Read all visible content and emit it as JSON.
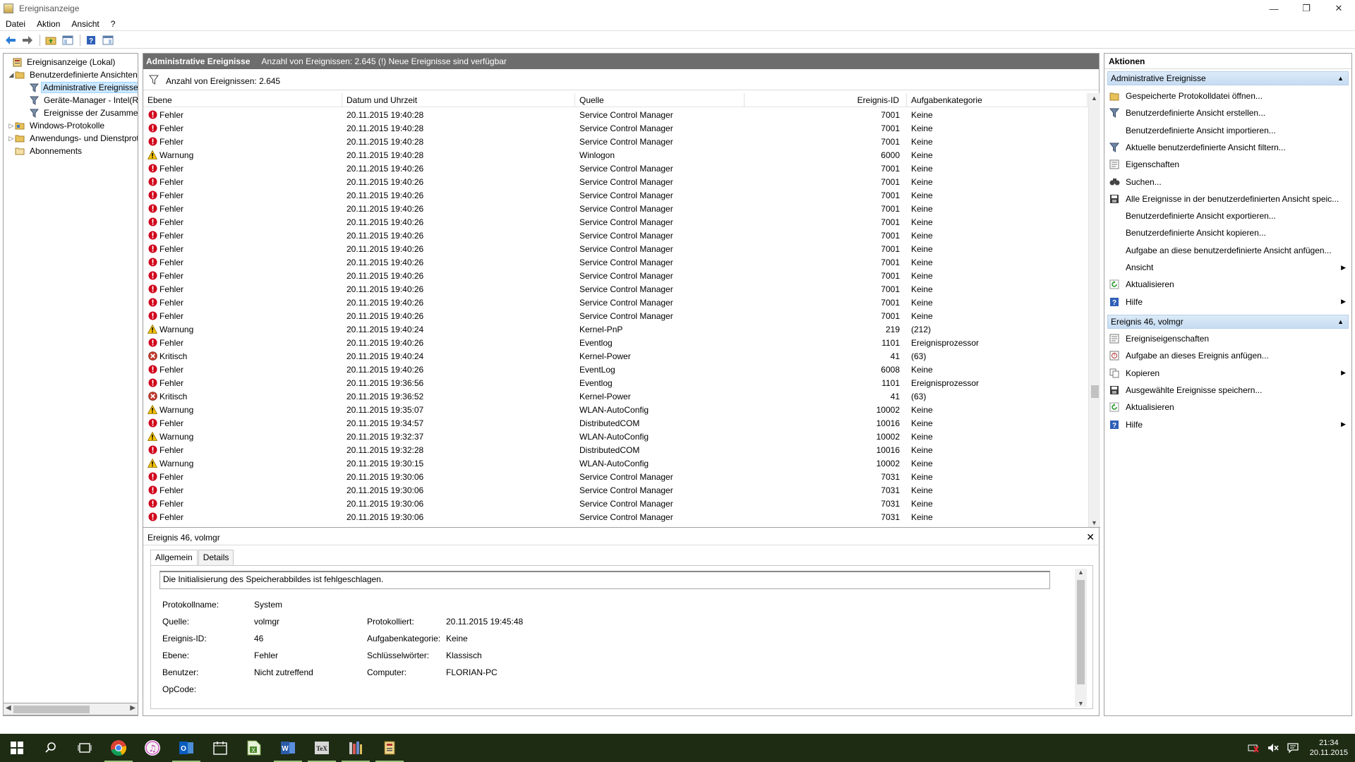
{
  "window": {
    "title": "Ereignisanzeige",
    "controls": {
      "minimize": "—",
      "restore": "❐",
      "close": "✕"
    }
  },
  "menu": [
    "Datei",
    "Aktion",
    "Ansicht",
    "?"
  ],
  "toolbar": {
    "buttons": [
      "back-icon",
      "forward-icon",
      "folder-up-icon",
      "show-hide-tree-icon",
      "help-icon",
      "show-hide-action-icon"
    ]
  },
  "tree": {
    "items": [
      {
        "label": "Ereignisanzeige (Lokal)",
        "icon": "event-viewer-icon",
        "indent": 0,
        "expander": ""
      },
      {
        "label": "Benutzerdefinierte Ansichten",
        "icon": "folder-icon",
        "indent": 1,
        "expander": "◢"
      },
      {
        "label": "Administrative Ereignisse",
        "icon": "filter-icon",
        "indent": 2,
        "expander": "",
        "selected": true
      },
      {
        "label": "Geräte-Manager - Intel(R) Dual Band Wireless",
        "icon": "filter-icon",
        "indent": 2,
        "expander": ""
      },
      {
        "label": "Ereignisse der Zusammenfassung",
        "icon": "filter-icon",
        "indent": 2,
        "expander": ""
      },
      {
        "label": "Windows-Protokolle",
        "icon": "folder-icon",
        "indent": 1,
        "expander": "▷"
      },
      {
        "label": "Anwendungs- und Dienstprotokolle",
        "icon": "folder-icon",
        "indent": 1,
        "expander": "▷"
      },
      {
        "label": "Abonnements",
        "icon": "subscription-icon",
        "indent": 1,
        "expander": ""
      }
    ]
  },
  "middle": {
    "header_title": "Administrative Ereignisse",
    "header_info": "Anzahl von Ereignissen: 2.645 (!) Neue Ereignisse sind verfügbar",
    "filter_label": "Anzahl von Ereignissen: 2.645",
    "columns": [
      "Ebene",
      "Datum und Uhrzeit",
      "Quelle",
      "Ereignis-ID",
      "Aufgabenkategorie"
    ],
    "rows": [
      {
        "level": "Fehler",
        "type": "error",
        "date": "20.11.2015 19:40:28",
        "source": "Service Control Manager",
        "id": "7001",
        "task": "Keine"
      },
      {
        "level": "Fehler",
        "type": "error",
        "date": "20.11.2015 19:40:28",
        "source": "Service Control Manager",
        "id": "7001",
        "task": "Keine"
      },
      {
        "level": "Fehler",
        "type": "error",
        "date": "20.11.2015 19:40:28",
        "source": "Service Control Manager",
        "id": "7001",
        "task": "Keine"
      },
      {
        "level": "Warnung",
        "type": "warning",
        "date": "20.11.2015 19:40:28",
        "source": "Winlogon",
        "id": "6000",
        "task": "Keine"
      },
      {
        "level": "Fehler",
        "type": "error",
        "date": "20.11.2015 19:40:26",
        "source": "Service Control Manager",
        "id": "7001",
        "task": "Keine"
      },
      {
        "level": "Fehler",
        "type": "error",
        "date": "20.11.2015 19:40:26",
        "source": "Service Control Manager",
        "id": "7001",
        "task": "Keine"
      },
      {
        "level": "Fehler",
        "type": "error",
        "date": "20.11.2015 19:40:26",
        "source": "Service Control Manager",
        "id": "7001",
        "task": "Keine"
      },
      {
        "level": "Fehler",
        "type": "error",
        "date": "20.11.2015 19:40:26",
        "source": "Service Control Manager",
        "id": "7001",
        "task": "Keine"
      },
      {
        "level": "Fehler",
        "type": "error",
        "date": "20.11.2015 19:40:26",
        "source": "Service Control Manager",
        "id": "7001",
        "task": "Keine"
      },
      {
        "level": "Fehler",
        "type": "error",
        "date": "20.11.2015 19:40:26",
        "source": "Service Control Manager",
        "id": "7001",
        "task": "Keine"
      },
      {
        "level": "Fehler",
        "type": "error",
        "date": "20.11.2015 19:40:26",
        "source": "Service Control Manager",
        "id": "7001",
        "task": "Keine"
      },
      {
        "level": "Fehler",
        "type": "error",
        "date": "20.11.2015 19:40:26",
        "source": "Service Control Manager",
        "id": "7001",
        "task": "Keine"
      },
      {
        "level": "Fehler",
        "type": "error",
        "date": "20.11.2015 19:40:26",
        "source": "Service Control Manager",
        "id": "7001",
        "task": "Keine"
      },
      {
        "level": "Fehler",
        "type": "error",
        "date": "20.11.2015 19:40:26",
        "source": "Service Control Manager",
        "id": "7001",
        "task": "Keine"
      },
      {
        "level": "Fehler",
        "type": "error",
        "date": "20.11.2015 19:40:26",
        "source": "Service Control Manager",
        "id": "7001",
        "task": "Keine"
      },
      {
        "level": "Fehler",
        "type": "error",
        "date": "20.11.2015 19:40:26",
        "source": "Service Control Manager",
        "id": "7001",
        "task": "Keine"
      },
      {
        "level": "Warnung",
        "type": "warning",
        "date": "20.11.2015 19:40:24",
        "source": "Kernel-PnP",
        "id": "219",
        "task": "(212)"
      },
      {
        "level": "Fehler",
        "type": "error",
        "date": "20.11.2015 19:40:26",
        "source": "Eventlog",
        "id": "1101",
        "task": "Ereignisprozessor"
      },
      {
        "level": "Kritisch",
        "type": "critical",
        "date": "20.11.2015 19:40:24",
        "source": "Kernel-Power",
        "id": "41",
        "task": "(63)"
      },
      {
        "level": "Fehler",
        "type": "error",
        "date": "20.11.2015 19:40:26",
        "source": "EventLog",
        "id": "6008",
        "task": "Keine"
      },
      {
        "level": "Fehler",
        "type": "error",
        "date": "20.11.2015 19:36:56",
        "source": "Eventlog",
        "id": "1101",
        "task": "Ereignisprozessor"
      },
      {
        "level": "Kritisch",
        "type": "critical",
        "date": "20.11.2015 19:36:52",
        "source": "Kernel-Power",
        "id": "41",
        "task": "(63)"
      },
      {
        "level": "Warnung",
        "type": "warning",
        "date": "20.11.2015 19:35:07",
        "source": "WLAN-AutoConfig",
        "id": "10002",
        "task": "Keine"
      },
      {
        "level": "Fehler",
        "type": "error",
        "date": "20.11.2015 19:34:57",
        "source": "DistributedCOM",
        "id": "10016",
        "task": "Keine"
      },
      {
        "level": "Warnung",
        "type": "warning",
        "date": "20.11.2015 19:32:37",
        "source": "WLAN-AutoConfig",
        "id": "10002",
        "task": "Keine"
      },
      {
        "level": "Fehler",
        "type": "error",
        "date": "20.11.2015 19:32:28",
        "source": "DistributedCOM",
        "id": "10016",
        "task": "Keine"
      },
      {
        "level": "Warnung",
        "type": "warning",
        "date": "20.11.2015 19:30:15",
        "source": "WLAN-AutoConfig",
        "id": "10002",
        "task": "Keine"
      },
      {
        "level": "Fehler",
        "type": "error",
        "date": "20.11.2015 19:30:06",
        "source": "Service Control Manager",
        "id": "7031",
        "task": "Keine"
      },
      {
        "level": "Fehler",
        "type": "error",
        "date": "20.11.2015 19:30:06",
        "source": "Service Control Manager",
        "id": "7031",
        "task": "Keine"
      },
      {
        "level": "Fehler",
        "type": "error",
        "date": "20.11.2015 19:30:06",
        "source": "Service Control Manager",
        "id": "7031",
        "task": "Keine"
      },
      {
        "level": "Fehler",
        "type": "error",
        "date": "20.11.2015 19:30:06",
        "source": "Service Control Manager",
        "id": "7031",
        "task": "Keine"
      }
    ]
  },
  "detail": {
    "title": "Ereignis 46, volmgr",
    "close": "✕",
    "tabs": [
      "Allgemein",
      "Details"
    ],
    "description": "Die Initialisierung des Speicherabbildes ist fehlgeschlagen.",
    "props_left": [
      {
        "label": "Protokollname:",
        "value": "System"
      },
      {
        "label": "Quelle:",
        "value": "volmgr"
      },
      {
        "label": "Ereignis-ID:",
        "value": "46"
      },
      {
        "label": "Ebene:",
        "value": "Fehler"
      },
      {
        "label": "Benutzer:",
        "value": "Nicht zutreffend"
      },
      {
        "label": "OpCode:",
        "value": ""
      }
    ],
    "props_right": [
      {
        "label": "Protokolliert:",
        "value": "20.11.2015 19:45:48"
      },
      {
        "label": "Aufgabenkategorie:",
        "value": "Keine"
      },
      {
        "label": "Schlüsselwörter:",
        "value": "Klassisch"
      },
      {
        "label": "Computer:",
        "value": "FLORIAN-PC"
      }
    ]
  },
  "actions": {
    "title": "Aktionen",
    "section1": "Administrative Ereignisse",
    "items1": [
      {
        "label": "Gespeicherte Protokolldatei öffnen...",
        "icon": "open-log-icon",
        "sub": false
      },
      {
        "label": "Benutzerdefinierte Ansicht erstellen...",
        "icon": "create-view-icon",
        "sub": false
      },
      {
        "label": "Benutzerdefinierte Ansicht importieren...",
        "icon": "",
        "sub": false
      },
      {
        "label": "Aktuelle benutzerdefinierte Ansicht filtern...",
        "icon": "filter-icon",
        "sub": false
      },
      {
        "label": "Eigenschaften",
        "icon": "properties-icon",
        "sub": false
      },
      {
        "label": "Suchen...",
        "icon": "binoculars-icon",
        "sub": false
      },
      {
        "label": "Alle Ereignisse in der benutzerdefinierten Ansicht speic...",
        "icon": "save-icon",
        "sub": false
      },
      {
        "label": "Benutzerdefinierte Ansicht exportieren...",
        "icon": "",
        "sub": false
      },
      {
        "label": "Benutzerdefinierte Ansicht kopieren...",
        "icon": "",
        "sub": false
      },
      {
        "label": "Aufgabe an diese benutzerdefinierte Ansicht anfügen...",
        "icon": "",
        "sub": false
      },
      {
        "label": "Ansicht",
        "icon": "",
        "sub": true
      },
      {
        "label": "Aktualisieren",
        "icon": "refresh-icon",
        "sub": false
      },
      {
        "label": "Hilfe",
        "icon": "help-icon",
        "sub": true
      }
    ],
    "section2": "Ereignis 46, volmgr",
    "items2": [
      {
        "label": "Ereigniseigenschaften",
        "icon": "properties-icon",
        "sub": false
      },
      {
        "label": "Aufgabe an dieses Ereignis anfügen...",
        "icon": "task-icon",
        "sub": false
      },
      {
        "label": "Kopieren",
        "icon": "copy-icon",
        "sub": true
      },
      {
        "label": "Ausgewählte Ereignisse speichern...",
        "icon": "save-icon",
        "sub": false
      },
      {
        "label": "Aktualisieren",
        "icon": "refresh-icon",
        "sub": false
      },
      {
        "label": "Hilfe",
        "icon": "help-icon",
        "sub": true
      }
    ]
  },
  "taskbar": {
    "apps": [
      "start-icon",
      "search-icon",
      "task-view-icon",
      "chrome-icon",
      "itunes-icon",
      "outlook-icon",
      "calendar-icon",
      "excel-icon",
      "word-icon",
      "latex-icon",
      "library-icon",
      "event-viewer-icon"
    ],
    "clock_time": "21:34",
    "clock_date": "20.11.2015"
  },
  "colors": {
    "error": "#d0021b",
    "warning": "#f5c400",
    "critical": "#c0392b",
    "header": "#6d6d6d",
    "section": "#cfe1f5",
    "taskbar": "#1e2c14"
  }
}
